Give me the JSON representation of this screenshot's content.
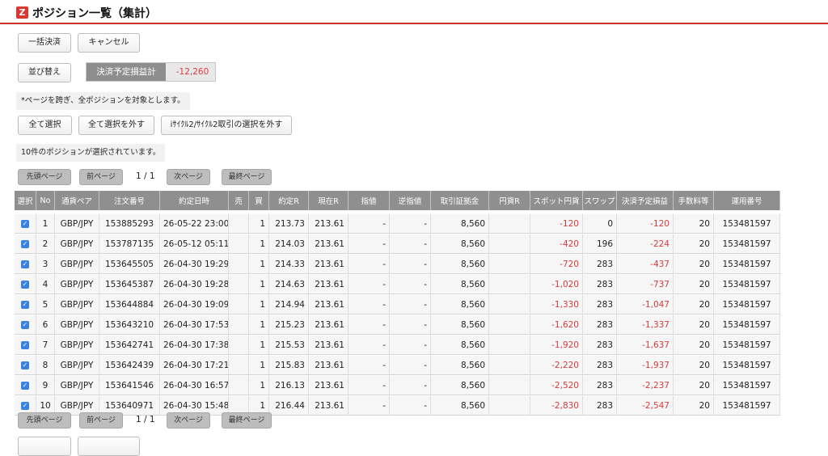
{
  "header": {
    "logo": "Z",
    "title": "ポジション一覧（集計）"
  },
  "actions": {
    "bulk_settle": "一括決済",
    "cancel": "キャンセル",
    "sort": "並び替え"
  },
  "pl_summary": {
    "label": "決済予定損益計",
    "value": "-12,260"
  },
  "note": "*ページを跨ぎ、全ポジションを対象とします。",
  "selection": {
    "select_all": "全て選択",
    "deselect_all": "全て選択を外す",
    "deselect_cycle": "iｻｲｸﾙ2/ｻｲｸﾙ2取引の選択を外す"
  },
  "selected_message": "10件のポジションが選択されています。",
  "pagination": {
    "first": "先頭ページ",
    "prev": "前ページ",
    "info": "1 / 1",
    "next": "次ページ",
    "last": "最終ページ"
  },
  "table": {
    "headers": [
      "選択",
      "No",
      "通貨ペア",
      "注文番号",
      "約定日時",
      "売",
      "買",
      "約定R",
      "現在R",
      "指値",
      "逆指値",
      "取引証拠金",
      "円貨R",
      "スポット円貨",
      "スワップ",
      "決済予定損益",
      "手数料等",
      "運用番号"
    ],
    "rows": [
      {
        "no": "1",
        "pair": "GBP/JPY",
        "order": "153885293",
        "time": "26-05-22 23:00",
        "sell": "",
        "buy": "1",
        "rate": "213.73",
        "cur": "213.61",
        "limit": "-",
        "stop": "-",
        "margin": "8,560",
        "yen": "",
        "spot": "-120",
        "swap": "0",
        "pl": "-120",
        "fee": "20",
        "op": "153481597"
      },
      {
        "no": "2",
        "pair": "GBP/JPY",
        "order": "153787135",
        "time": "26-05-12 05:11",
        "sell": "",
        "buy": "1",
        "rate": "214.03",
        "cur": "213.61",
        "limit": "-",
        "stop": "-",
        "margin": "8,560",
        "yen": "",
        "spot": "-420",
        "swap": "196",
        "pl": "-224",
        "fee": "20",
        "op": "153481597"
      },
      {
        "no": "3",
        "pair": "GBP/JPY",
        "order": "153645505",
        "time": "26-04-30 19:29",
        "sell": "",
        "buy": "1",
        "rate": "214.33",
        "cur": "213.61",
        "limit": "-",
        "stop": "-",
        "margin": "8,560",
        "yen": "",
        "spot": "-720",
        "swap": "283",
        "pl": "-437",
        "fee": "20",
        "op": "153481597"
      },
      {
        "no": "4",
        "pair": "GBP/JPY",
        "order": "153645387",
        "time": "26-04-30 19:28",
        "sell": "",
        "buy": "1",
        "rate": "214.63",
        "cur": "213.61",
        "limit": "-",
        "stop": "-",
        "margin": "8,560",
        "yen": "",
        "spot": "-1,020",
        "swap": "283",
        "pl": "-737",
        "fee": "20",
        "op": "153481597"
      },
      {
        "no": "5",
        "pair": "GBP/JPY",
        "order": "153644884",
        "time": "26-04-30 19:09",
        "sell": "",
        "buy": "1",
        "rate": "214.94",
        "cur": "213.61",
        "limit": "-",
        "stop": "-",
        "margin": "8,560",
        "yen": "",
        "spot": "-1,330",
        "swap": "283",
        "pl": "-1,047",
        "fee": "20",
        "op": "153481597"
      },
      {
        "no": "6",
        "pair": "GBP/JPY",
        "order": "153643210",
        "time": "26-04-30 17:53",
        "sell": "",
        "buy": "1",
        "rate": "215.23",
        "cur": "213.61",
        "limit": "-",
        "stop": "-",
        "margin": "8,560",
        "yen": "",
        "spot": "-1,620",
        "swap": "283",
        "pl": "-1,337",
        "fee": "20",
        "op": "153481597"
      },
      {
        "no": "7",
        "pair": "GBP/JPY",
        "order": "153642741",
        "time": "26-04-30 17:38",
        "sell": "",
        "buy": "1",
        "rate": "215.53",
        "cur": "213.61",
        "limit": "-",
        "stop": "-",
        "margin": "8,560",
        "yen": "",
        "spot": "-1,920",
        "swap": "283",
        "pl": "-1,637",
        "fee": "20",
        "op": "153481597"
      },
      {
        "no": "8",
        "pair": "GBP/JPY",
        "order": "153642439",
        "time": "26-04-30 17:21",
        "sell": "",
        "buy": "1",
        "rate": "215.83",
        "cur": "213.61",
        "limit": "-",
        "stop": "-",
        "margin": "8,560",
        "yen": "",
        "spot": "-2,220",
        "swap": "283",
        "pl": "-1,937",
        "fee": "20",
        "op": "153481597"
      },
      {
        "no": "9",
        "pair": "GBP/JPY",
        "order": "153641546",
        "time": "26-04-30 16:57",
        "sell": "",
        "buy": "1",
        "rate": "216.13",
        "cur": "213.61",
        "limit": "-",
        "stop": "-",
        "margin": "8,560",
        "yen": "",
        "spot": "-2,520",
        "swap": "283",
        "pl": "-2,237",
        "fee": "20",
        "op": "153481597"
      },
      {
        "no": "10",
        "pair": "GBP/JPY",
        "order": "153640971",
        "time": "26-04-30 15:48",
        "sell": "",
        "buy": "1",
        "rate": "216.44",
        "cur": "213.61",
        "limit": "-",
        "stop": "-",
        "margin": "8,560",
        "yen": "",
        "spot": "-2,830",
        "swap": "283",
        "pl": "-2,547",
        "fee": "20",
        "op": "153481597"
      }
    ]
  },
  "colors": {
    "accent": "#c9302c",
    "negative": "#d83b3b",
    "header_bg": "#8f8f8f",
    "checkbox": "#3b82e0"
  }
}
